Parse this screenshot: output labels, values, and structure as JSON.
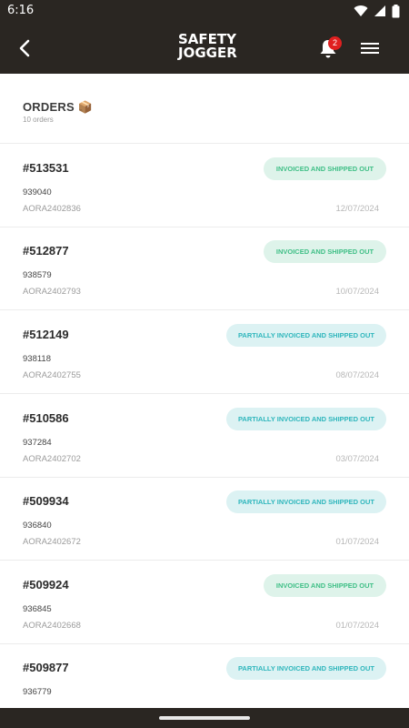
{
  "status_bar": {
    "time": "6:16"
  },
  "app_bar": {
    "logo_line1": "SAFETY",
    "logo_line2": "JOGGER",
    "notification_count": "2"
  },
  "header": {
    "title": "ORDERS 📦",
    "count": "10 orders"
  },
  "colors": {
    "bar": "#2a2622",
    "shipped": "#3fbf86",
    "partial": "#2eb6bc"
  },
  "orders": [
    {
      "number": "#513531",
      "ref": "939040",
      "code": "AORA2402836",
      "date": "12/07/2024",
      "status": "INVOICED AND SHIPPED OUT"
    },
    {
      "number": "#512877",
      "ref": "938579",
      "code": "AORA2402793",
      "date": "10/07/2024",
      "status": "INVOICED AND SHIPPED OUT"
    },
    {
      "number": "#512149",
      "ref": "938118",
      "code": "AORA2402755",
      "date": "08/07/2024",
      "status": "PARTIALLY INVOICED AND SHIPPED OUT"
    },
    {
      "number": "#510586",
      "ref": "937284",
      "code": "AORA2402702",
      "date": "03/07/2024",
      "status": "PARTIALLY INVOICED AND SHIPPED OUT"
    },
    {
      "number": "#509934",
      "ref": "936840",
      "code": "AORA2402672",
      "date": "01/07/2024",
      "status": "PARTIALLY INVOICED AND SHIPPED OUT"
    },
    {
      "number": "#509924",
      "ref": "936845",
      "code": "AORA2402668",
      "date": "01/07/2024",
      "status": "INVOICED AND SHIPPED OUT"
    },
    {
      "number": "#509877",
      "ref": "936779",
      "code": "",
      "date": "",
      "status": "PARTIALLY INVOICED AND SHIPPED OUT"
    }
  ]
}
